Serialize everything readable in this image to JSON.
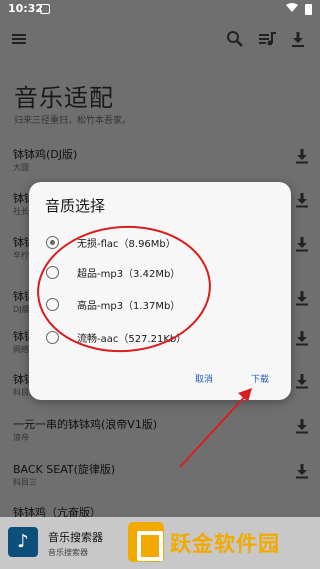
{
  "status": {
    "time": "10:32"
  },
  "page": {
    "title": "音乐适配",
    "subtitle": "归来三径重扫，松竹本吾家。"
  },
  "songs": [
    {
      "name": "钵钵鸡(DJ版)",
      "artist": "大圆"
    },
    {
      "name": "钵钵",
      "artist": "社长"
    },
    {
      "name": "钵钵",
      "artist": "辛柠"
    },
    {
      "name": "钵钵",
      "artist": "DJ晨"
    },
    {
      "name": "钵钵",
      "artist": "网络"
    },
    {
      "name": "钵钵",
      "artist": "科目"
    },
    {
      "name": "一元一串的钵钵鸡(浪帝V1版)",
      "artist": "浪帝"
    },
    {
      "name": "BACK SEAT(旋律版)",
      "artist": "科目三"
    },
    {
      "name": "钵钵鸡（亢奋版）",
      "artist": ""
    }
  ],
  "dialog": {
    "title": "音质选择",
    "options": [
      {
        "label": "无损-flac（8.96Mb）",
        "selected": true
      },
      {
        "label": "超品-mp3（3.42Mb）",
        "selected": false
      },
      {
        "label": "高品-mp3（1.37Mb）",
        "selected": false
      },
      {
        "label": "流畅-aac（527.21Kb）",
        "selected": false
      }
    ],
    "cancel_label": "取消",
    "download_label": "下载"
  },
  "player": {
    "title": "音乐搜索器",
    "subtitle": "音乐搜索器"
  },
  "watermark": {
    "text": "跃金软件园"
  },
  "colors": {
    "accent": "#1f5db8",
    "annotation": "#d81e1e",
    "watermark": "#f2a900"
  },
  "icons": [
    "menu-icon",
    "search-icon",
    "playlist-icon",
    "download-icon",
    "wifi-icon",
    "battery-icon",
    "music-note-icon"
  ]
}
